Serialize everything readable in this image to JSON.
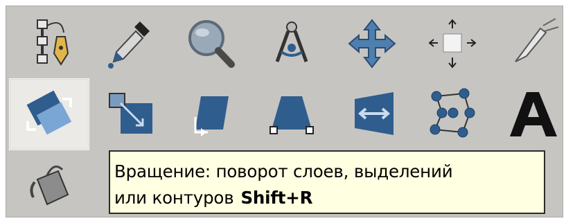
{
  "toolbox": {
    "tools": [
      {
        "name": "paths-tool",
        "icon": "pen-path-icon"
      },
      {
        "name": "color-picker-tool",
        "icon": "eyedropper-icon"
      },
      {
        "name": "magnify-tool",
        "icon": "magnifier-icon"
      },
      {
        "name": "measure-tool",
        "icon": "compass-icon"
      },
      {
        "name": "move-tool",
        "icon": "move-arrows-icon"
      },
      {
        "name": "align-tool",
        "icon": "align-icon"
      },
      {
        "name": "crop-tool",
        "icon": "scalpel-icon"
      },
      {
        "name": "rotate-tool",
        "icon": "rotate-icon",
        "active": true
      },
      {
        "name": "scale-tool",
        "icon": "scale-icon"
      },
      {
        "name": "shear-tool",
        "icon": "shear-icon"
      },
      {
        "name": "perspective-tool",
        "icon": "perspective-icon"
      },
      {
        "name": "flip-tool",
        "icon": "flip-icon"
      },
      {
        "name": "cage-transform-tool",
        "icon": "cage-icon"
      },
      {
        "name": "text-tool",
        "icon": "text-a-icon"
      },
      {
        "name": "bucket-fill-tool",
        "icon": "bucket-icon"
      }
    ]
  },
  "tooltip": {
    "line1": "Вращение: поворот слоев, выделений",
    "line2": "или контуров",
    "shortcut": "Shift+R"
  },
  "colors": {
    "toolbox_bg": "#c7c5c1",
    "tooltip_bg": "#ffffe1",
    "icon_blue": "#2f5d8e",
    "icon_blue_light": "#7aa6d6"
  }
}
